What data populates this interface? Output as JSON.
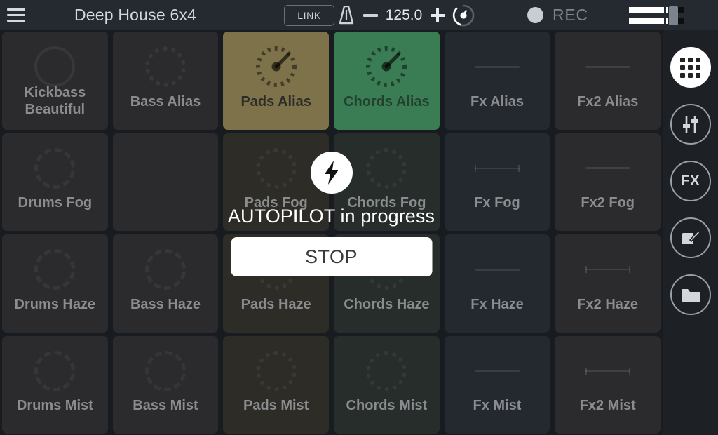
{
  "topbar": {
    "menu_icon": "hamburger-menu-icon",
    "project_title": "Deep House 6x4",
    "link_label": "LINK",
    "metronome_icon": "metronome-icon",
    "bpm_minus": "−",
    "bpm_value": "125.0",
    "bpm_plus": "+",
    "tap_tempo_icon": "tap-tempo-dial-icon",
    "rec_icon": "record-circle-icon",
    "rec_label": "REC",
    "mixer_icon": "mixer-faders-icon"
  },
  "grid": {
    "columns": [
      "Drums",
      "Bass",
      "Pads",
      "Chords",
      "Fx",
      "Fx2"
    ],
    "rows": [
      "Alias",
      "Fog",
      "Haze",
      "Mist"
    ],
    "cells": [
      {
        "label": "Kickbass\nBeautiful",
        "col": "drums",
        "widget": "ring",
        "ring": "solid",
        "active": false,
        "empty": false
      },
      {
        "label": "Bass Alias",
        "col": "bass",
        "widget": "ring",
        "ring": "dash-b",
        "active": false,
        "empty": false
      },
      {
        "label": "Pads Alias",
        "col": "pads",
        "widget": "dial",
        "ring": "dash-b",
        "active": true,
        "empty": false
      },
      {
        "label": "Chords Alias",
        "col": "chords",
        "widget": "dial",
        "ring": "dash-b",
        "active": true,
        "empty": false
      },
      {
        "label": "Fx Alias",
        "col": "fx",
        "widget": "line",
        "caps": false,
        "active": false,
        "empty": false
      },
      {
        "label": "Fx2 Alias",
        "col": "fx2",
        "widget": "line",
        "caps": false,
        "active": false,
        "empty": false
      },
      {
        "label": "Drums Fog",
        "col": "drums",
        "widget": "ring",
        "ring": "dash-a",
        "active": false,
        "empty": false
      },
      {
        "label": "",
        "col": "bass",
        "widget": "none",
        "active": false,
        "empty": true
      },
      {
        "label": "Pads Fog",
        "col": "pads",
        "widget": "ring",
        "ring": "dash-b",
        "active": false,
        "empty": false
      },
      {
        "label": "Chords Fog",
        "col": "chords",
        "widget": "ring",
        "ring": "dash-b",
        "active": false,
        "empty": false
      },
      {
        "label": "Fx Fog",
        "col": "fx",
        "widget": "line",
        "caps": true,
        "active": false,
        "empty": false
      },
      {
        "label": "Fx2 Fog",
        "col": "fx2",
        "widget": "line",
        "caps": false,
        "active": false,
        "empty": false
      },
      {
        "label": "Drums Haze",
        "col": "drums",
        "widget": "ring",
        "ring": "dash-a",
        "active": false,
        "empty": false
      },
      {
        "label": "Bass Haze",
        "col": "bass",
        "widget": "ring",
        "ring": "dash-a",
        "active": false,
        "empty": false
      },
      {
        "label": "Pads Haze",
        "col": "pads",
        "widget": "ring",
        "ring": "dash-b",
        "active": false,
        "empty": false
      },
      {
        "label": "Chords Haze",
        "col": "chords",
        "widget": "ring",
        "ring": "dash-b",
        "active": false,
        "empty": false
      },
      {
        "label": "Fx Haze",
        "col": "fx",
        "widget": "line",
        "caps": false,
        "active": false,
        "empty": false
      },
      {
        "label": "Fx2 Haze",
        "col": "fx2",
        "widget": "line",
        "caps": true,
        "active": false,
        "empty": false
      },
      {
        "label": "Drums Mist",
        "col": "drums",
        "widget": "ring",
        "ring": "dash-a",
        "active": false,
        "empty": false
      },
      {
        "label": "Bass Mist",
        "col": "bass",
        "widget": "ring",
        "ring": "dash-c",
        "active": false,
        "empty": false
      },
      {
        "label": "Pads Mist",
        "col": "pads",
        "widget": "ring",
        "ring": "dash-b",
        "active": false,
        "empty": false
      },
      {
        "label": "Chords Mist",
        "col": "chords",
        "widget": "ring",
        "ring": "dash-b",
        "active": false,
        "empty": false
      },
      {
        "label": "Fx Mist",
        "col": "fx",
        "widget": "line",
        "caps": false,
        "active": false,
        "empty": false
      },
      {
        "label": "Fx2 Mist",
        "col": "fx2",
        "widget": "line",
        "caps": true,
        "active": false,
        "empty": false
      }
    ]
  },
  "rail": {
    "items": [
      {
        "name": "grid-view-button",
        "icon": "grid-icon",
        "label": "",
        "active": true
      },
      {
        "name": "mixer-view-button",
        "icon": "faders-icon",
        "label": "",
        "active": false
      },
      {
        "name": "fx-view-button",
        "icon": "fx-text-icon",
        "label": "FX",
        "active": false
      },
      {
        "name": "edit-view-button",
        "icon": "edit-pencil-icon",
        "label": "",
        "active": false
      },
      {
        "name": "files-view-button",
        "icon": "folder-icon",
        "label": "",
        "active": false
      }
    ]
  },
  "autopilot": {
    "icon": "lightning-bolt-icon",
    "status_text": "AUTOPILOT in progress",
    "stop_label": "STOP"
  },
  "colors": {
    "background": "#181c21",
    "topbar": "#242a30",
    "rail": "#1d2126",
    "cell": "#2b2a2c",
    "pads_active": "#7d7249",
    "chords_active": "#3a7c54",
    "accent_white": "#ffffff",
    "label_text": "#8b8c90"
  }
}
